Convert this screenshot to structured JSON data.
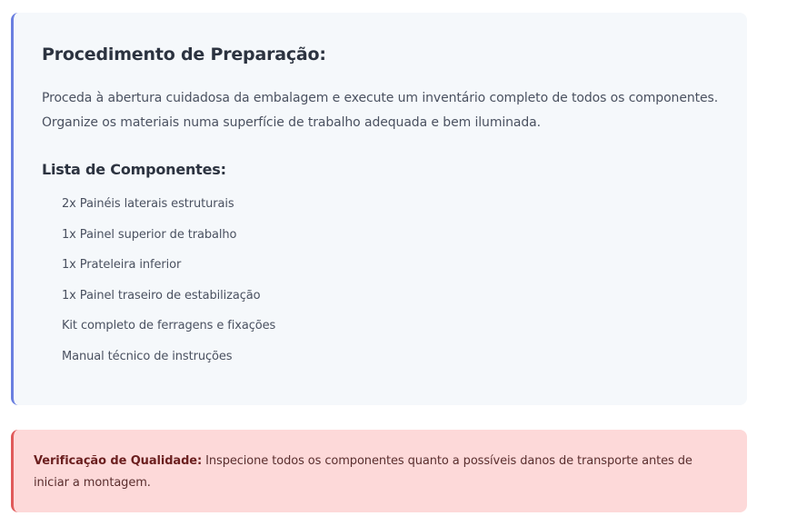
{
  "preparation": {
    "title": "Procedimento de Preparação:",
    "paragraph_line1": "Proceda à abertura cuidadosa da embalagem e execute um inventário completo de todos os componentes.",
    "paragraph_line2": "Organize os materiais numa superfície de trabalho adequada e bem iluminada.",
    "components_title": "Lista de Componentes:",
    "components": [
      "2x Painéis laterais estruturais",
      "1x Painel superior de trabalho",
      "1x Prateleira inferior",
      "1x Painel traseiro de estabilização",
      "Kit completo de ferragens e fixações",
      "Manual técnico de instruções"
    ]
  },
  "warning": {
    "label": "Verificação de Qualidade:",
    "text": " Inspecione todos os componentes quanto a possíveis danos de transporte antes de iniciar a montagem."
  },
  "colors": {
    "info_accent": "#6a7fe0",
    "info_background": "#f5f8fb",
    "warning_accent": "#e05a5a",
    "warning_background": "#fdd9d9"
  }
}
